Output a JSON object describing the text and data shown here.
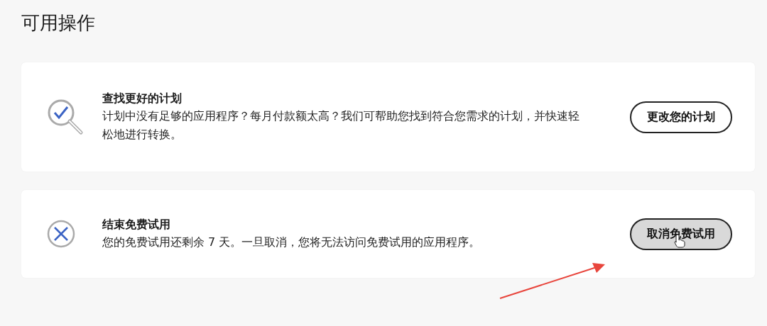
{
  "page_title": "可用操作",
  "actions": [
    {
      "kind": "find",
      "title": "查找更好的计划",
      "description": "计划中没有足够的应用程序？每月付款额太高？我们可帮助您找到符合您需求的计划，并快速轻松地进行转换。",
      "button": "更改您的计划",
      "hovered": false
    },
    {
      "kind": "cancel",
      "title": "结束免费试用",
      "description": "您的免费试用还剩余 7 天。一旦取消，您将无法访问免费试用的应用程序。",
      "button": "取消免费试用",
      "hovered": true
    }
  ]
}
